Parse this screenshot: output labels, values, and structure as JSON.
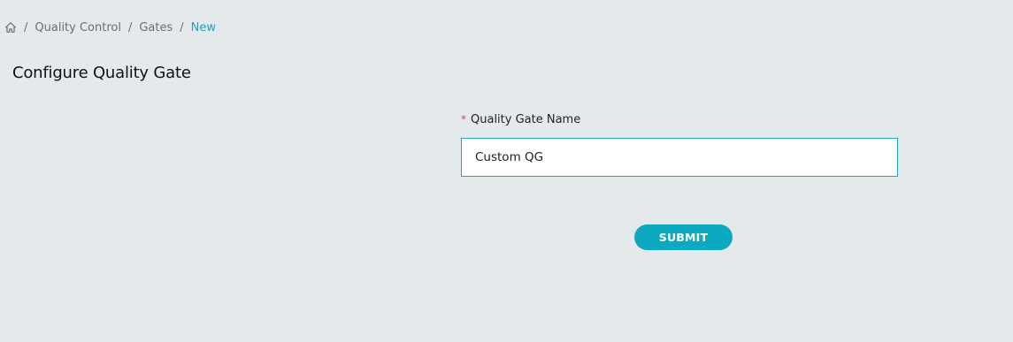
{
  "breadcrumb": {
    "home_icon": "home-icon",
    "separator": "/",
    "items": [
      {
        "label": "Quality Control"
      },
      {
        "label": "Gates"
      },
      {
        "label": "New"
      }
    ]
  },
  "page": {
    "title": "Configure Quality Gate"
  },
  "form": {
    "name_field": {
      "required_marker": "*",
      "label": "Quality Gate Name",
      "value": "Custom QG"
    },
    "submit_label": "SUBMIT"
  },
  "colors": {
    "background": "#e4e9ec",
    "accent": "#0da9c0",
    "active_breadcrumb": "#1ba3bd",
    "required": "#e0464b"
  }
}
